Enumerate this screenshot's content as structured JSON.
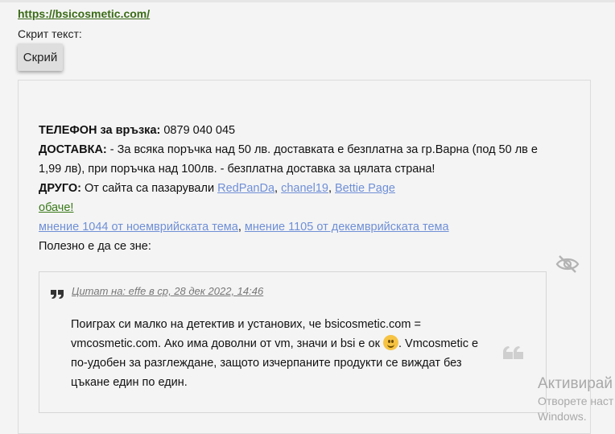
{
  "link_url": "https://bsicosmetic.com/",
  "hidden_text_label": "Скрит текст:",
  "hide_button_label": "Скрий",
  "content": {
    "phone_label": "ТЕЛЕФОН за връзка:",
    "phone_value": " 0879 040 045",
    "delivery_label": "ДОСТАВКА:",
    "delivery_text": " - За всяка поръчка над 50 лв. доставката е безплатна за гр.Варна (под 50 лв е 1,99 лв), при поръчка над 100лв. - безплатна доставка за цялата страна!",
    "other_label": "ДРУГО:",
    "other_text": " От сайта са пазарували ",
    "user1": "RedPanDa",
    "user2": "chanel19",
    "user3": "Bettie Page",
    "sep": ", ",
    "however_link": "обаче!",
    "opinion1": "мнение 1044 от ноемврийската тема",
    "opinion2": "мнение 1105 от декемврийската тема",
    "useful": "Полезно е да се зне:"
  },
  "quote": {
    "cite": "Цитат на: effe в ср, 28 дек 2022, 14:46",
    "text_part1": "Поиграх си малко на детектив и установих, че bsicosmetic.com = vmcosmetic.com. Ако има доволни от vm, значи и bsi е ок ",
    "text_part2": ". Vmcosmetic е по-удобен за разглеждане, защото изчерпаните продукти се виждат без цъкане един по един."
  },
  "watermark": {
    "line1": "Активирай",
    "line2": "Отворете наст",
    "line3": "Windows."
  },
  "icons": {
    "eye": "eye-slash-icon",
    "quote_open": "quote-open-icon",
    "quote_close": "quote-close-icon",
    "smiley": "smiley-icon"
  },
  "colors": {
    "link_green": "#3a6b16",
    "link_blue": "#6f8fd6",
    "background": "#f4f4f4"
  }
}
